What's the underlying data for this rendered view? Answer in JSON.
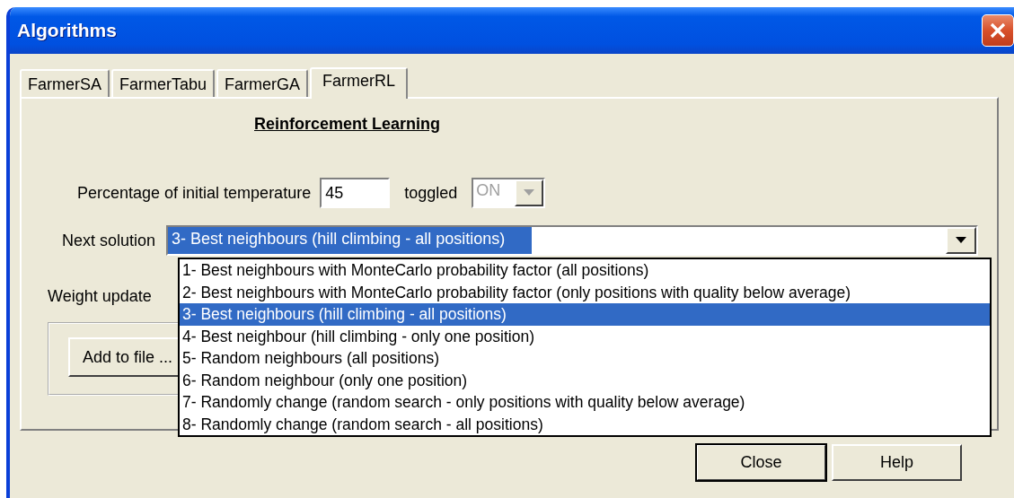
{
  "window": {
    "title": "Algorithms"
  },
  "tabs": [
    {
      "label": "FarmerSA",
      "selected": false
    },
    {
      "label": "FarmerTabu",
      "selected": false
    },
    {
      "label": "FarmerGA",
      "selected": false
    },
    {
      "label": "FarmerRL",
      "selected": true
    }
  ],
  "panel": {
    "heading": "Reinforcement Learning",
    "temperature": {
      "label": "Percentage of initial temperature",
      "value": "45"
    },
    "toggled": {
      "label": "toggled",
      "value": "ON",
      "disabled": true
    },
    "next_solution": {
      "label": "Next solution",
      "value": "3- Best neighbours (hill climbing - all positions)",
      "expanded": true,
      "options": [
        {
          "label": "1- Best neighbours with MonteCarlo probability factor (all positions)",
          "selected": false
        },
        {
          "label": "2- Best neighbours with MonteCarlo probability factor (only positions with quality below average)",
          "selected": false
        },
        {
          "label": "3- Best neighbours (hill climbing - all positions)",
          "selected": true
        },
        {
          "label": "4- Best neighbour (hill climbing - only one position)",
          "selected": false
        },
        {
          "label": "5- Random neighbours (all positions)",
          "selected": false
        },
        {
          "label": "6- Random neighbour (only one position)",
          "selected": false
        },
        {
          "label": "7- Randomly change (random search - only positions with quality below average)",
          "selected": false
        },
        {
          "label": "8- Randomly change (random search - all positions)",
          "selected": false
        }
      ]
    },
    "weight_update": {
      "label": "Weight update"
    },
    "add_to_file_button": "Add to file ..."
  },
  "buttons": [
    {
      "label": "Close",
      "default": true
    },
    {
      "label": "Help",
      "default": false
    }
  ]
}
